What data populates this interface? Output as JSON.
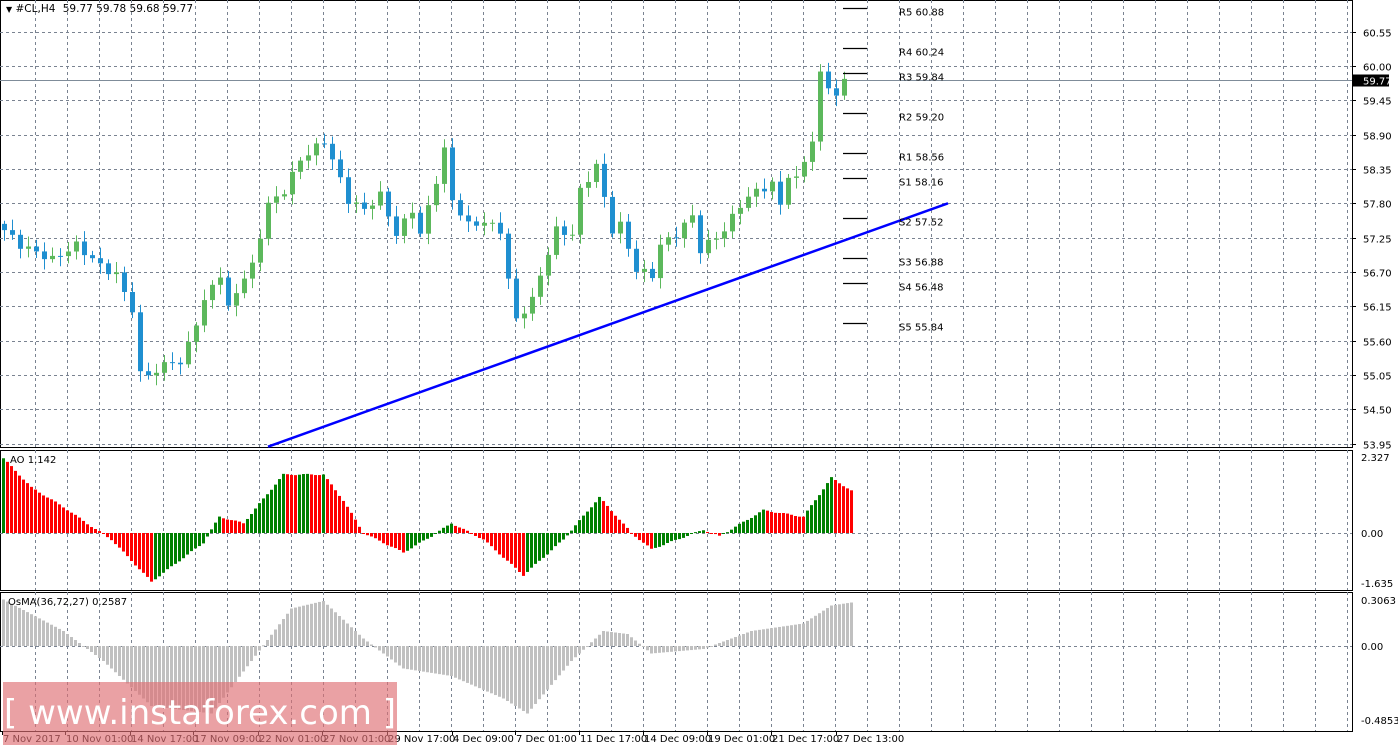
{
  "header": {
    "arrow": "▼",
    "symbol": "#CL,H4",
    "ohlc": "59.77 59.78 59.68 59.77"
  },
  "colors": {
    "bull": "#5cb85c",
    "bear": "#1f8fd0",
    "trend": "#0000ff",
    "ao_up": "#008000",
    "ao_down": "#ff0000",
    "osma": "#c0c0c0",
    "grid": "#7a8391"
  },
  "watermark": "[ www.instaforex.com ]",
  "chart_data": [
    {
      "type": "candlestick",
      "title": "#CL,H4",
      "current_price": "59.77",
      "ylim": [
        53.95,
        60.88
      ],
      "y_ticks": [
        "60.55",
        "60.00",
        "59.45",
        "58.90",
        "58.35",
        "57.80",
        "57.25",
        "56.70",
        "56.15",
        "55.60",
        "55.05",
        "54.50",
        "53.95"
      ],
      "x_ticks": [
        "7 Nov 2017",
        "10 Nov 01:00",
        "14 Nov 17:00",
        "17 Nov 09:00",
        "22 Nov 01:00",
        "27 Nov 01:00",
        "29 Nov 17:00",
        "4 Dec 09:00",
        "7 Dec 01:00",
        "11 Dec 17:00",
        "14 Dec 09:00",
        "19 Dec 01:00",
        "21 Dec 17:00",
        "27 Dec 13:00"
      ],
      "close_waypoints": [
        [
          0,
          57.37
        ],
        [
          2,
          57.13
        ],
        [
          6,
          56.9
        ],
        [
          9,
          57.13
        ],
        [
          12,
          56.8
        ],
        [
          14,
          56.65
        ],
        [
          16,
          56.1
        ],
        [
          17,
          55.05
        ],
        [
          19,
          55.1
        ],
        [
          21,
          55.3
        ],
        [
          22,
          55.2
        ],
        [
          24,
          55.9
        ],
        [
          26,
          56.5
        ],
        [
          27,
          56.65
        ],
        [
          28,
          56.1
        ],
        [
          29,
          56.4
        ],
        [
          31,
          56.8
        ],
        [
          33,
          57.78
        ],
        [
          35,
          58.0
        ],
        [
          37,
          58.5
        ],
        [
          40,
          58.8
        ],
        [
          41,
          58.5
        ],
        [
          43,
          57.85
        ],
        [
          45,
          57.7
        ],
        [
          47,
          57.93
        ],
        [
          49,
          57.3
        ],
        [
          51,
          57.7
        ],
        [
          52,
          57.3
        ],
        [
          54,
          58.17
        ],
        [
          55,
          58.65
        ],
        [
          56,
          57.85
        ],
        [
          58,
          57.45
        ],
        [
          60,
          57.5
        ],
        [
          62,
          57.37
        ],
        [
          63,
          56.57
        ],
        [
          64,
          55.93
        ],
        [
          66,
          56.25
        ],
        [
          67,
          56.65
        ],
        [
          69,
          57.37
        ],
        [
          71,
          57.3
        ],
        [
          72,
          58.0
        ],
        [
          74,
          58.4
        ],
        [
          76,
          57.37
        ],
        [
          77,
          57.45
        ],
        [
          79,
          56.73
        ],
        [
          81,
          56.65
        ],
        [
          82,
          57.13
        ],
        [
          84,
          57.3
        ],
        [
          86,
          57.6
        ],
        [
          87,
          57.05
        ],
        [
          90,
          57.37
        ],
        [
          92,
          57.78
        ],
        [
          94,
          58.0
        ],
        [
          96,
          58.1
        ],
        [
          97,
          57.78
        ],
        [
          98,
          58.25
        ],
        [
          99,
          58.17
        ],
        [
          100,
          58.5
        ],
        [
          101,
          58.8
        ],
        [
          102,
          59.86
        ],
        [
          103,
          59.7
        ],
        [
          104,
          59.5
        ],
        [
          105,
          59.77
        ]
      ],
      "trendline": {
        "from": [
          33,
          53.9
        ],
        "to": [
          118,
          57.8
        ]
      },
      "pivots": [
        {
          "label": "R5 60.88",
          "value": 60.88
        },
        {
          "label": "R4 60.24",
          "value": 60.24
        },
        {
          "label": "R3 59.84",
          "value": 59.84
        },
        {
          "label": "R2 59.20",
          "value": 59.2
        },
        {
          "label": "R1 58.56",
          "value": 58.56
        },
        {
          "label": "S1 58.16",
          "value": 58.16
        },
        {
          "label": "S2 57.52",
          "value": 57.52
        },
        {
          "label": "S3 56.88",
          "value": 56.88
        },
        {
          "label": "S4 56.48",
          "value": 56.48
        },
        {
          "label": "S5 55.84",
          "value": 55.84
        }
      ]
    },
    {
      "type": "bar",
      "title": "AO 1.142",
      "ylim": [
        -1.635,
        2.327
      ],
      "y_ticks": [
        "2.327",
        "0.00",
        "-1.635"
      ],
      "waypoints": [
        [
          0,
          2.3
        ],
        [
          7,
          1.4
        ],
        [
          15,
          0.8
        ],
        [
          22,
          0.2
        ],
        [
          27,
          -0.2
        ],
        [
          37,
          -1.5
        ],
        [
          50,
          -0.3
        ],
        [
          54,
          0.5
        ],
        [
          60,
          0.3
        ],
        [
          70,
          1.8
        ],
        [
          80,
          1.8
        ],
        [
          85,
          1.0
        ],
        [
          90,
          0.0
        ],
        [
          100,
          -0.6
        ],
        [
          107,
          -0.1
        ],
        [
          112,
          0.3
        ],
        [
          120,
          -0.2
        ],
        [
          130,
          -1.3
        ],
        [
          140,
          -0.2
        ],
        [
          149,
          1.1
        ],
        [
          157,
          0.0
        ],
        [
          162,
          -0.5
        ],
        [
          175,
          0.1
        ],
        [
          179,
          -0.1
        ],
        [
          190,
          0.7
        ],
        [
          200,
          0.5
        ],
        [
          207,
          1.7
        ],
        [
          212,
          1.3
        ]
      ]
    },
    {
      "type": "bar",
      "title": "OsMA(36,72,27) 0.2587",
      "ylim": [
        -0.4853,
        0.3063
      ],
      "y_ticks": [
        "0.3063",
        "0.00",
        "-0.4853"
      ],
      "waypoints": [
        [
          0,
          0.31
        ],
        [
          15,
          0.1
        ],
        [
          25,
          -0.1
        ],
        [
          37,
          -0.4
        ],
        [
          52,
          -0.45
        ],
        [
          62,
          -0.1
        ],
        [
          72,
          0.25
        ],
        [
          80,
          0.3
        ],
        [
          90,
          0.05
        ],
        [
          100,
          -0.15
        ],
        [
          112,
          -0.2
        ],
        [
          125,
          -0.35
        ],
        [
          131,
          -0.45
        ],
        [
          142,
          -0.1
        ],
        [
          150,
          0.1
        ],
        [
          156,
          0.08
        ],
        [
          162,
          -0.05
        ],
        [
          175,
          -0.02
        ],
        [
          187,
          0.1
        ],
        [
          200,
          0.15
        ],
        [
          207,
          0.27
        ],
        [
          212,
          0.29
        ]
      ]
    }
  ]
}
